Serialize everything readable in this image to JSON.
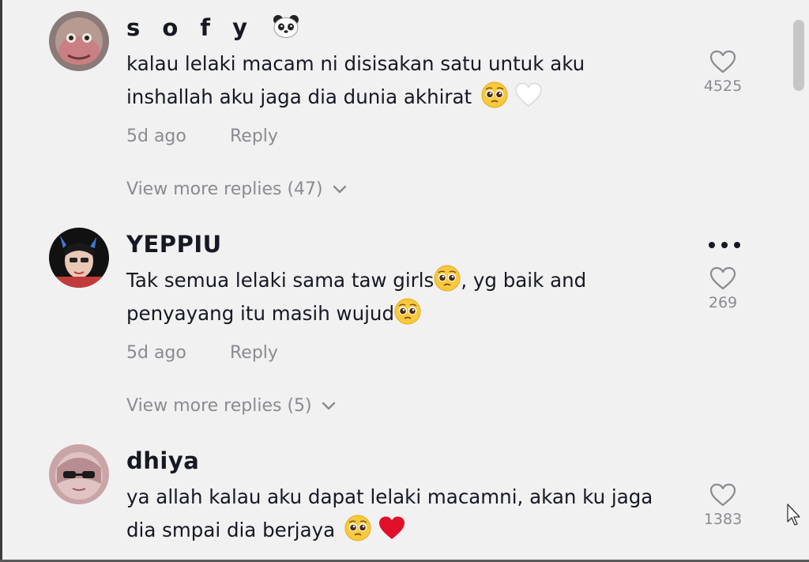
{
  "comments": [
    {
      "username": "s o f y",
      "username_suffix_icon": "panda-face-icon",
      "line1": "kalau lelaki macam ni disisakan satu untuk aku",
      "line2": "inshallah aku jaga dia dunia akhirat",
      "line2_emojis": [
        "pleading-face-emoji",
        "white-heart-emoji"
      ],
      "time": "5d ago",
      "reply_label": "Reply",
      "more_replies": "View more replies (47)",
      "likes": "4525"
    },
    {
      "username": "YEPPIU",
      "line1_a": "Tak semua lelaki sama taw girls",
      "line1_b": ", yg baik and",
      "line2": "penyayang itu masih wujud",
      "time": "5d ago",
      "reply_label": "Reply",
      "more_replies": "View more replies (5)",
      "likes": "269",
      "options_icon": "more-options-icon"
    },
    {
      "username": "dhiya",
      "line1": "ya allah kalau aku dapat lelaki macamni, akan ku jaga",
      "line2": "dia smpai dia berjaya",
      "line2_emojis": [
        "pleading-face-emoji",
        "red-heart-emoji"
      ],
      "likes": "1383"
    }
  ],
  "colors": {
    "background": "#f1f1f1",
    "primary_text": "#161823",
    "secondary_text": "#8a8b91",
    "heart_red": "#e0102a"
  }
}
